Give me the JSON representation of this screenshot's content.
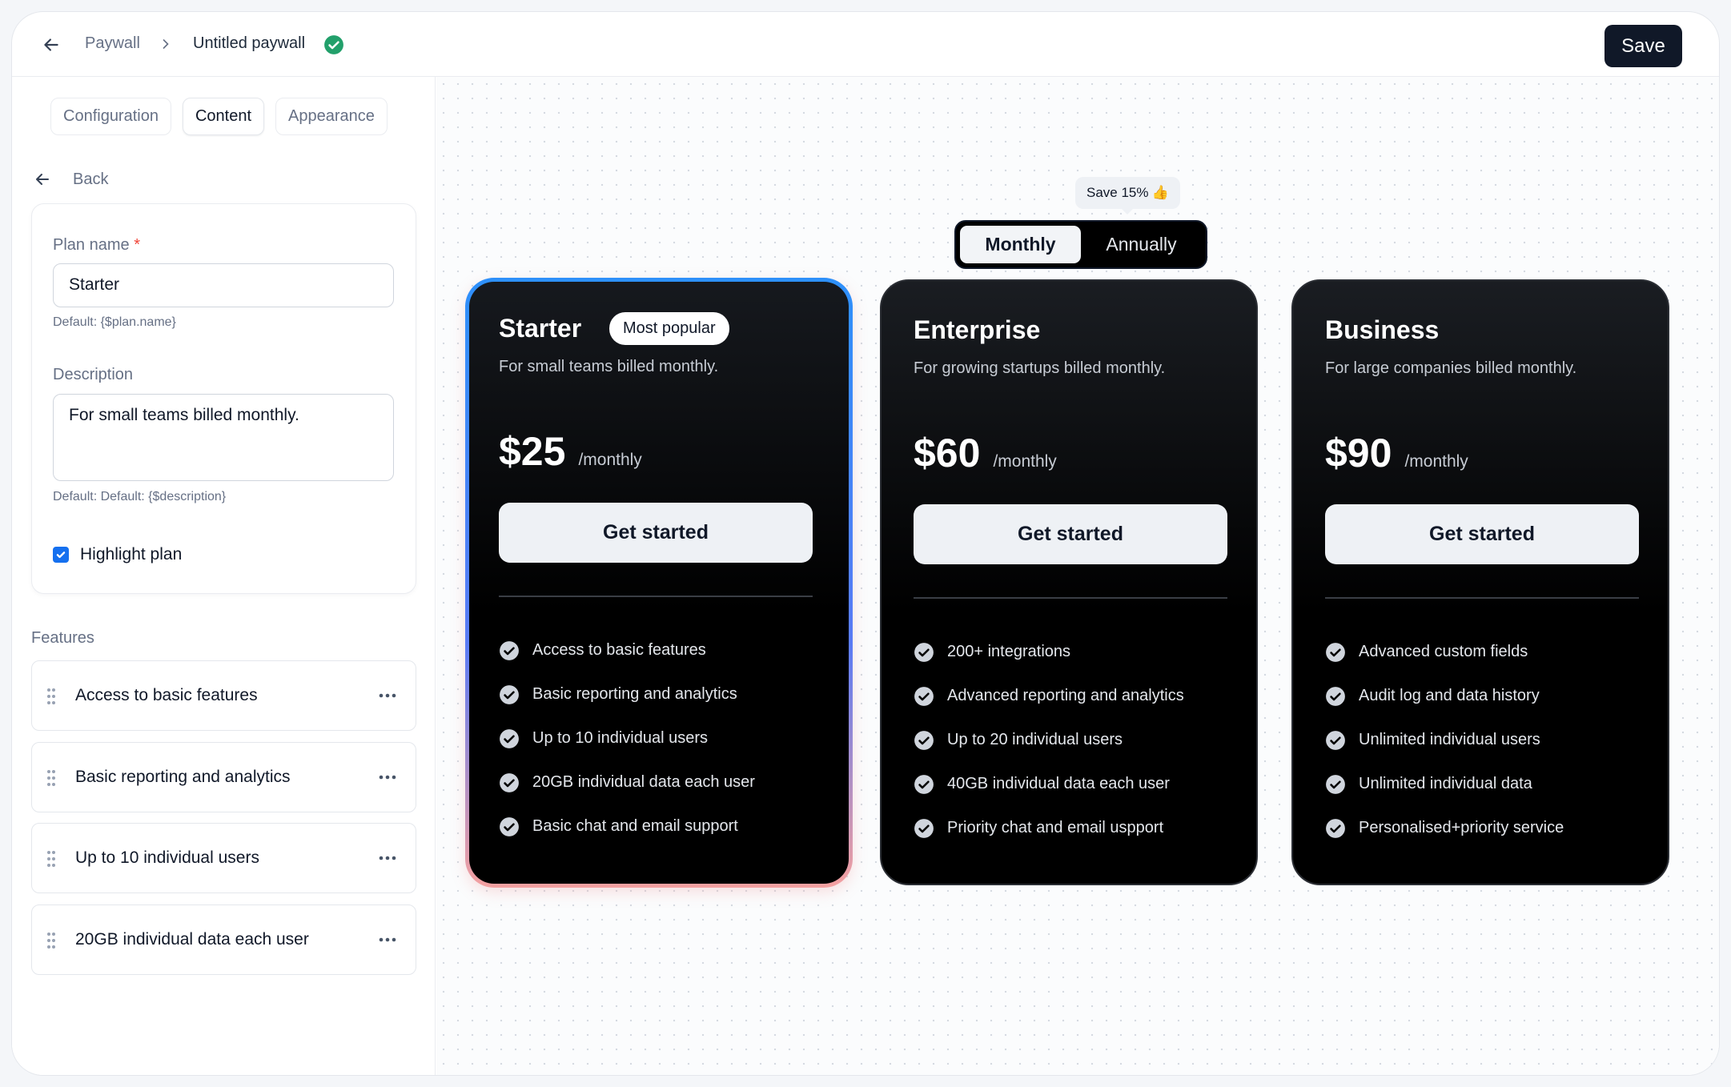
{
  "header": {
    "breadcrumb_root": "Paywall",
    "breadcrumb_current": "Untitled paywall",
    "save_label": "Save"
  },
  "sidebar": {
    "tabs": [
      {
        "label": "Configuration",
        "active": false
      },
      {
        "label": "Content",
        "active": true
      },
      {
        "label": "Appearance",
        "active": false
      }
    ],
    "back_label": "Back",
    "form": {
      "plan_name_label": "Plan name",
      "required_mark": "*",
      "plan_name_value": "Starter",
      "plan_name_hint": "Default: {$plan.name}",
      "description_label": "Description",
      "description_value": "For small teams billed monthly.",
      "description_hint": "Default: Default: {$description}",
      "highlight_label": "Highlight plan",
      "highlight_checked": true
    },
    "features_title": "Features",
    "features": [
      "Access to basic features",
      "Basic reporting and analytics",
      "Up to 10 individual users",
      "20GB individual data each user"
    ]
  },
  "preview": {
    "save_badge": "Save 15%",
    "save_badge_emoji": "👍",
    "billing_toggle": {
      "monthly": "Monthly",
      "annually": "Annually",
      "selected": "monthly"
    },
    "plans": [
      {
        "name": "Starter",
        "badge": "Most popular",
        "description": "For small teams billed monthly.",
        "price": "$25",
        "period": "/monthly",
        "cta": "Get started",
        "highlighted": true,
        "features": [
          "Access to basic features",
          "Basic reporting and analytics",
          "Up to 10 individual users",
          "20GB individual data each user",
          "Basic chat and email support"
        ]
      },
      {
        "name": "Enterprise",
        "description": "For growing startups billed monthly.",
        "price": "$60",
        "period": "/monthly",
        "cta": "Get started",
        "highlighted": false,
        "features": [
          "200+ integrations",
          "Advanced reporting and analytics",
          "Up to 20 individual users",
          "40GB individual data each user",
          "Priority chat and email uspport"
        ]
      },
      {
        "name": "Business",
        "description": "For large companies billed monthly.",
        "price": "$90",
        "period": "/monthly",
        "cta": "Get started",
        "highlighted": false,
        "features": [
          "Advanced custom fields",
          "Audit log and data history",
          "Unlimited individual users",
          "Unlimited individual data",
          "Personalised+priority service"
        ]
      }
    ]
  },
  "colors": {
    "accent": "#1570ef",
    "success": "#22a06b",
    "dark": "#101828"
  }
}
